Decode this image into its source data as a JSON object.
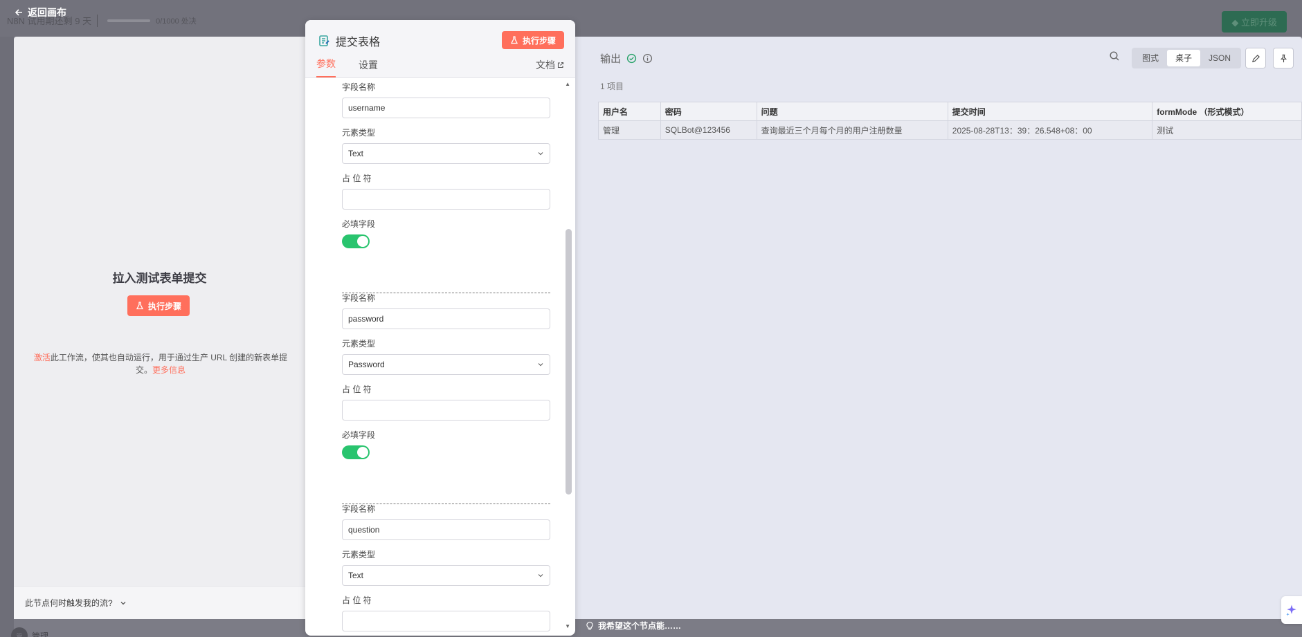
{
  "background": {
    "trial_text": "N8N 试用期还剩 9 天",
    "executions": "0/1000 处决",
    "upgrade_label": "立即升级",
    "user_initials": "管",
    "user_name": "管理"
  },
  "back_label": "返回画布",
  "left_panel": {
    "title": "拉入测试表单提交",
    "exec_label": "执行步骤",
    "desc_link": "激活",
    "desc_text": "此工作流，使其也自动运行，用于通过生产 URL 创建的新表单提交。",
    "more_link": "更多信息",
    "bottom_label": "此节点何时触发我的流?"
  },
  "node": {
    "title": "提交表格",
    "exec_label": "执行步骤",
    "tabs": [
      "参数",
      "设置"
    ],
    "docs_label": "文档",
    "field_label": "字段名称",
    "type_label": "元素类型",
    "placeholder_label": "占 位 符",
    "required_label": "必填字段",
    "fields": [
      {
        "name": "username",
        "type": "Text",
        "placeholder": "",
        "required": true
      },
      {
        "name": "password",
        "type": "Password",
        "placeholder": "",
        "required": true
      },
      {
        "name": "question",
        "type": "Text",
        "placeholder": ""
      }
    ]
  },
  "output": {
    "title": "输出",
    "count": "1 项目",
    "views": [
      "图式",
      "桌子",
      "JSON"
    ],
    "active_view": "桌子",
    "columns": [
      "用户名",
      "密码",
      "问题",
      "提交时间",
      "formMode （形式模式）"
    ],
    "rows": [
      [
        "管理",
        "SQLBot@123456",
        "查询最近三个月每个月的用户注册数量",
        "2025-08-28T13：39：26.548+08：00",
        "测试"
      ]
    ]
  },
  "hint_label": "我希望这个节点能……",
  "colors": {
    "accent": "#ff6f5c",
    "toggle_on": "#29c46e",
    "success": "#29a36a"
  }
}
